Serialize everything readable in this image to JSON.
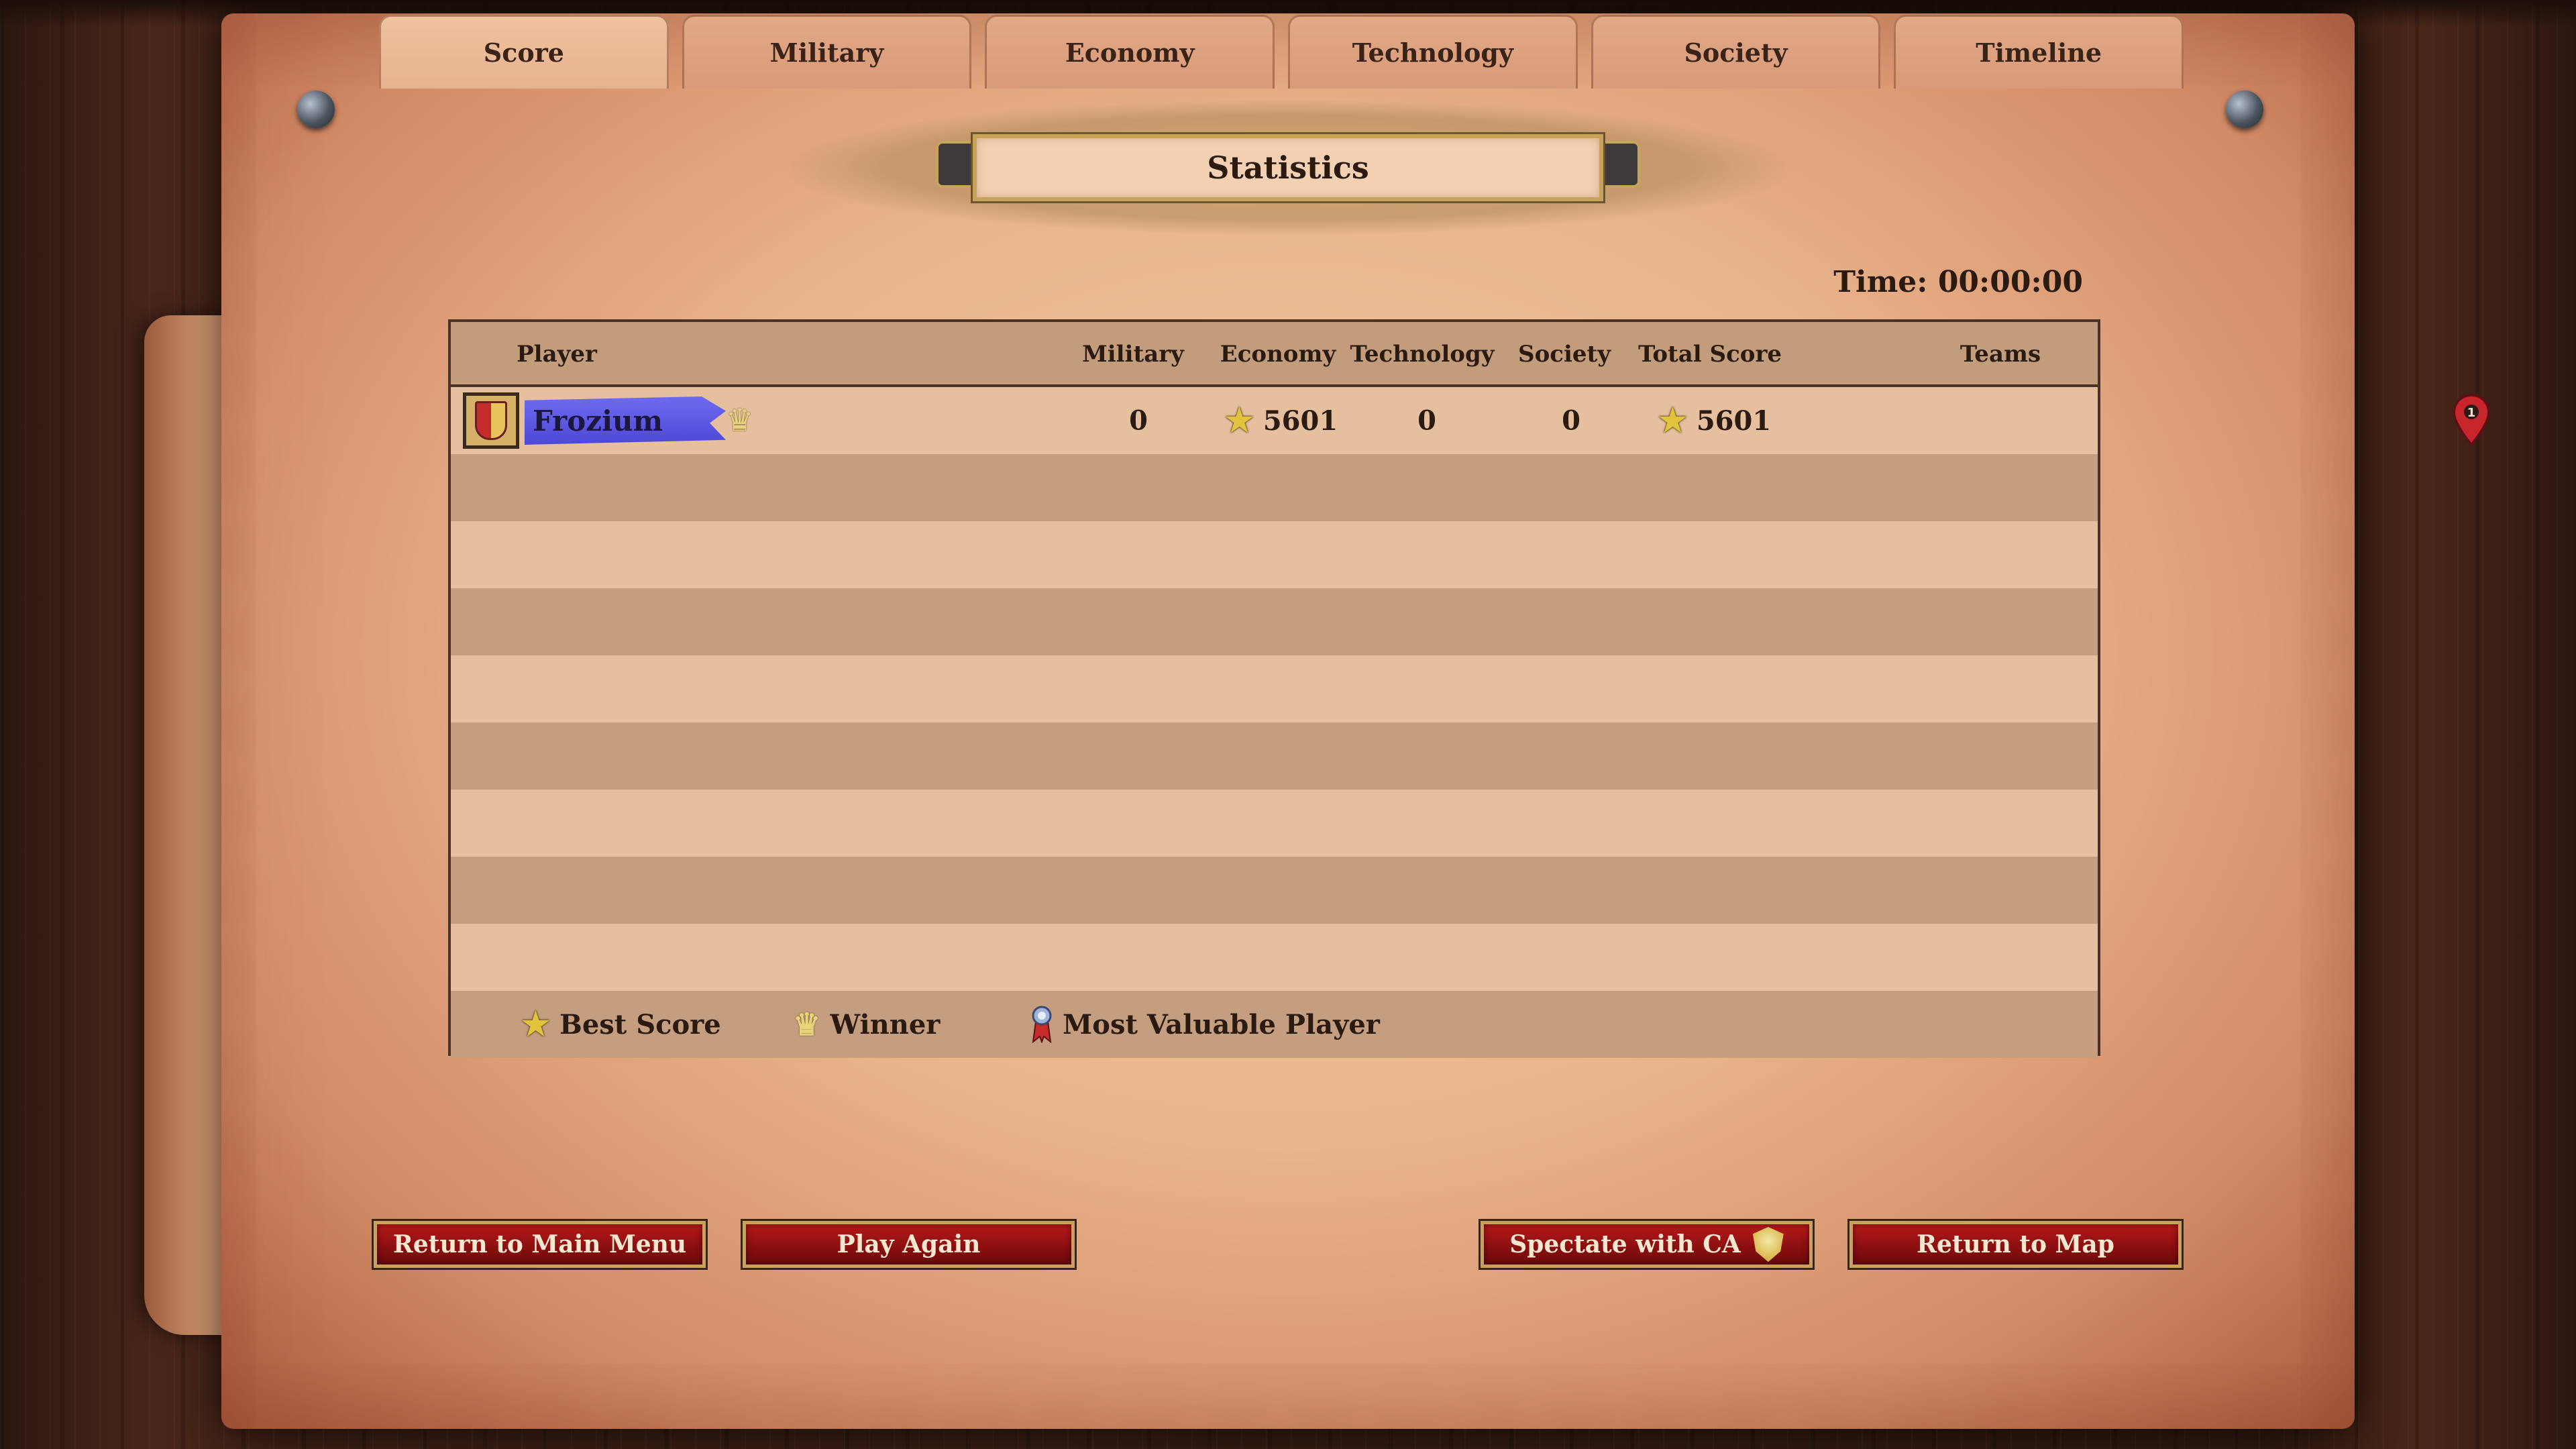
{
  "tabs": [
    "Score",
    "Military",
    "Economy",
    "Technology",
    "Society",
    "Timeline"
  ],
  "active_tab": "Score",
  "title": "Statistics",
  "time": "Time: 00:00:00",
  "table": {
    "headers": {
      "player": "Player",
      "military": "Military",
      "economy": "Economy",
      "technology": "Technology",
      "society": "Society",
      "total": "Total Score",
      "teams": "Teams"
    },
    "players": [
      {
        "name": "Frozium",
        "color": "#5a55e6",
        "military": "0",
        "economy": "5601",
        "technology": "0",
        "society": "0",
        "total": "5601",
        "team": "1",
        "winner": true,
        "best_economy": true,
        "best_total": true
      }
    ]
  },
  "legend": {
    "best_score": "Best Score",
    "winner": "Winner",
    "mvp": "Most Valuable Player"
  },
  "buttons": {
    "main_menu": "Return to Main Menu",
    "play_again": "Play Again",
    "spectate": "Spectate with CA",
    "return_map": "Return to Map"
  },
  "icons": {
    "best_score": "star-icon",
    "winner": "crown-icon",
    "mvp": "medal-icon",
    "team": "team-marker-icon",
    "spectate": "ca-shield-icon"
  }
}
